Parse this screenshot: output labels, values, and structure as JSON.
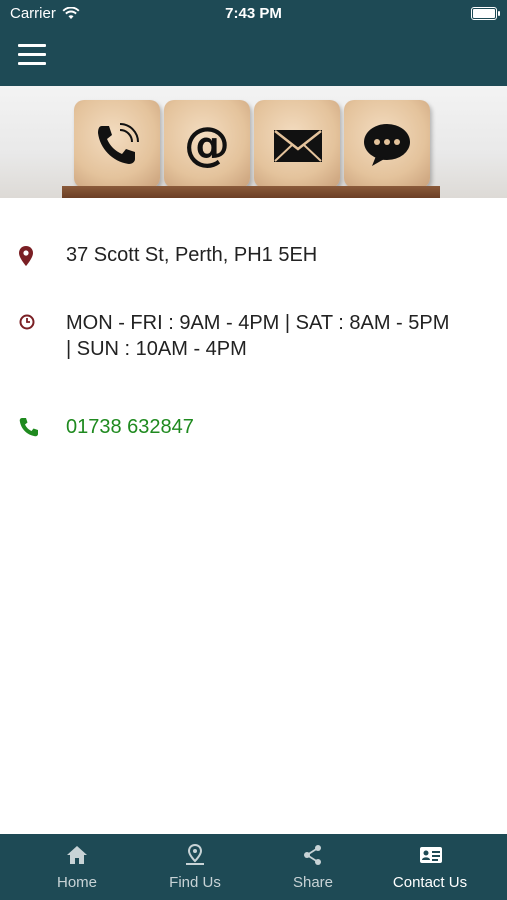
{
  "status_bar": {
    "carrier": "Carrier",
    "time": "7:43 PM"
  },
  "banner": {
    "icons": [
      "phone-icon",
      "at-sign-icon",
      "envelope-icon",
      "chat-bubble-icon"
    ]
  },
  "contact": {
    "address": "37 Scott St, Perth, PH1 5EH",
    "hours": "MON - FRI : 9AM - 4PM | SAT : 8AM - 5PM | SUN : 10AM - 4PM",
    "phone": "01738 632847"
  },
  "tabs": [
    {
      "label": "Home",
      "icon": "home-icon"
    },
    {
      "label": "Find Us",
      "icon": "map-pin-icon"
    },
    {
      "label": "Share",
      "icon": "share-icon"
    },
    {
      "label": "Contact Us",
      "icon": "contact-card-icon",
      "active": true
    }
  ],
  "colors": {
    "header": "#1e4a55",
    "icon_red": "#7a1f24",
    "phone_green": "#1f8a1f"
  }
}
